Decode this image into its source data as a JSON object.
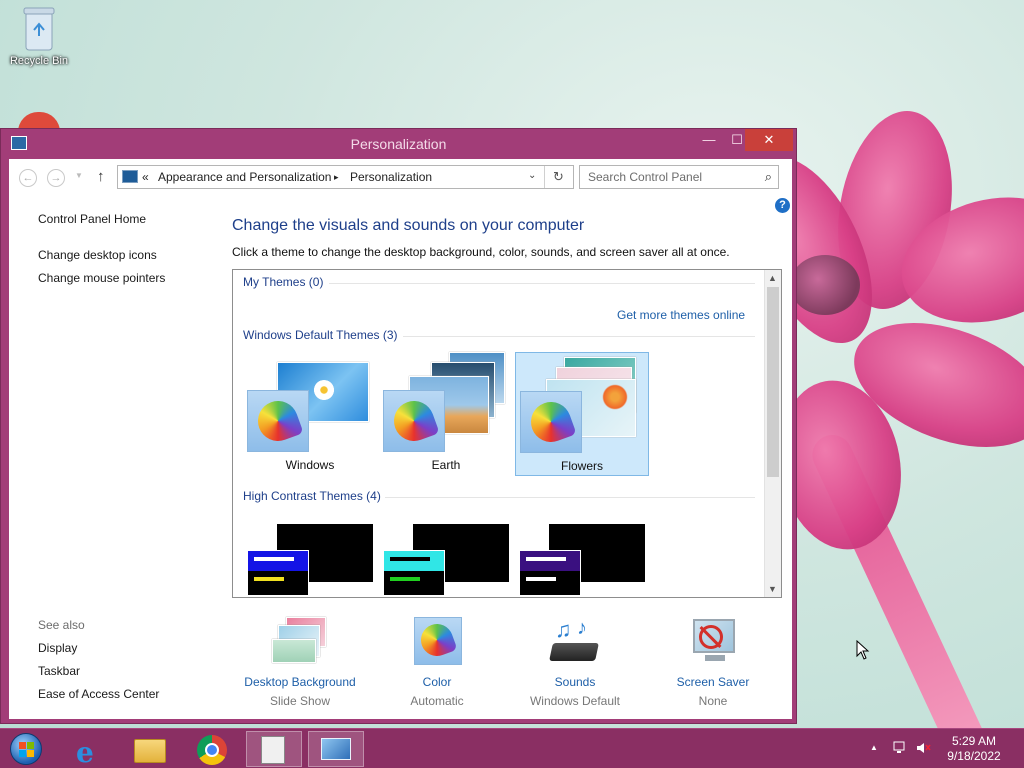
{
  "desktop": {
    "recycle_bin_label": "Recycle Bin"
  },
  "window": {
    "title": "Personalization",
    "controls": {
      "minimize": "—",
      "maximize": "☐",
      "close": "✕"
    }
  },
  "address_bar": {
    "overflow": "«",
    "crumbs": [
      "Appearance and Personalization",
      "Personalization"
    ],
    "separator": "▸",
    "search_placeholder": "Search Control Panel"
  },
  "left_panel": {
    "links": [
      "Control Panel Home",
      "Change desktop icons",
      "Change mouse pointers"
    ],
    "see_also_label": "See also",
    "see_also": [
      "Display",
      "Taskbar",
      "Ease of Access Center"
    ]
  },
  "main": {
    "heading": "Change the visuals and sounds on your computer",
    "subtext": "Click a theme to change the desktop background, color, sounds, and screen saver all at once.",
    "help_glyph": "?",
    "get_more_link": "Get more themes online",
    "groups": {
      "my": "My Themes (0)",
      "default": "Windows Default Themes (3)",
      "contrast": "High Contrast Themes (4)"
    },
    "default_themes": [
      {
        "name": "Windows",
        "selected": false
      },
      {
        "name": "Earth",
        "selected": false
      },
      {
        "name": "Flowers",
        "selected": true
      }
    ],
    "contrast_themes": [
      {
        "bar": "#1414e6",
        "line1": "#ffffff",
        "line2": "#f0e020"
      },
      {
        "bar": "#30e6e6",
        "line1": "#000000",
        "line2": "#20d020"
      },
      {
        "bar": "#3a1080",
        "line1": "#ffffff",
        "line2": "#ffffff"
      }
    ]
  },
  "bottom": [
    {
      "title": "Desktop Background",
      "sub": "Slide Show"
    },
    {
      "title": "Color",
      "sub": "Automatic"
    },
    {
      "title": "Sounds",
      "sub": "Windows Default"
    },
    {
      "title": "Screen Saver",
      "sub": "None"
    }
  ],
  "taskbar": {
    "time": "5:29 AM",
    "date": "9/18/2022",
    "tray_arrow": "▲"
  },
  "colors": {
    "window_frame": "#a23d78",
    "taskbar": "#8a2f63",
    "link_blue": "#1e5fa8",
    "heading_blue": "#1e3f8a",
    "close_red": "#c9403a"
  }
}
